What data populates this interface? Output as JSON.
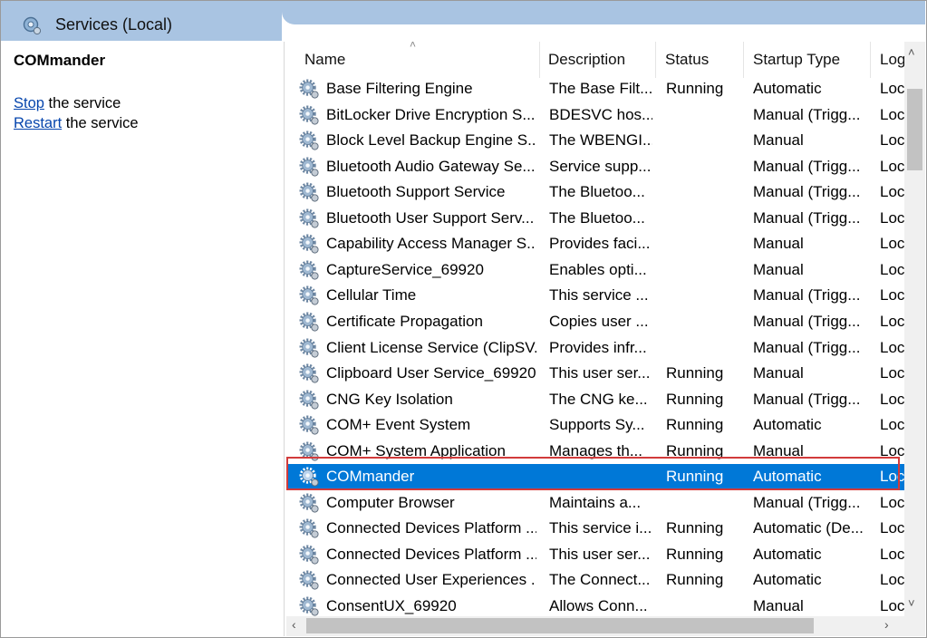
{
  "window": {
    "title": "Services (Local)"
  },
  "left_pane": {
    "selected_service": "COMmander",
    "actions": [
      {
        "link": "Stop",
        "rest": " the service"
      },
      {
        "link": "Restart",
        "rest": " the service"
      }
    ]
  },
  "table": {
    "columns": [
      "Name",
      "Description",
      "Status",
      "Startup Type",
      "Log"
    ],
    "rows": [
      {
        "name": "Base Filtering Engine",
        "description": "The Base Filt...",
        "status": "Running",
        "startup": "Automatic",
        "log": "Loc"
      },
      {
        "name": "BitLocker Drive Encryption S...",
        "description": "BDESVC hos...",
        "status": "",
        "startup": "Manual (Trigg...",
        "log": "Loc"
      },
      {
        "name": "Block Level Backup Engine S...",
        "description": "The WBENGI...",
        "status": "",
        "startup": "Manual",
        "log": "Loc"
      },
      {
        "name": "Bluetooth Audio Gateway Se...",
        "description": "Service supp...",
        "status": "",
        "startup": "Manual (Trigg...",
        "log": "Loc"
      },
      {
        "name": "Bluetooth Support Service",
        "description": "The Bluetoo...",
        "status": "",
        "startup": "Manual (Trigg...",
        "log": "Loc"
      },
      {
        "name": "Bluetooth User Support Serv...",
        "description": "The Bluetoo...",
        "status": "",
        "startup": "Manual (Trigg...",
        "log": "Loc"
      },
      {
        "name": "Capability Access Manager S...",
        "description": "Provides faci...",
        "status": "",
        "startup": "Manual",
        "log": "Loc"
      },
      {
        "name": "CaptureService_69920",
        "description": "Enables opti...",
        "status": "",
        "startup": "Manual",
        "log": "Loc"
      },
      {
        "name": "Cellular Time",
        "description": "This service ...",
        "status": "",
        "startup": "Manual (Trigg...",
        "log": "Loc"
      },
      {
        "name": "Certificate Propagation",
        "description": "Copies user ...",
        "status": "",
        "startup": "Manual (Trigg...",
        "log": "Loc"
      },
      {
        "name": "Client License Service (ClipSV...",
        "description": "Provides infr...",
        "status": "",
        "startup": "Manual (Trigg...",
        "log": "Loc"
      },
      {
        "name": "Clipboard User Service_69920",
        "description": "This user ser...",
        "status": "Running",
        "startup": "Manual",
        "log": "Loc"
      },
      {
        "name": "CNG Key Isolation",
        "description": "The CNG ke...",
        "status": "Running",
        "startup": "Manual (Trigg...",
        "log": "Loc"
      },
      {
        "name": "COM+ Event System",
        "description": "Supports Sy...",
        "status": "Running",
        "startup": "Automatic",
        "log": "Loc"
      },
      {
        "name": "COM+ System Application",
        "description": "Manages th...",
        "status": "Running",
        "startup": "Manual",
        "log": "Loc"
      },
      {
        "name": "COMmander",
        "description": "",
        "status": "Running",
        "startup": "Automatic",
        "log": "Loc",
        "selected": true
      },
      {
        "name": "Computer Browser",
        "description": "Maintains a...",
        "status": "",
        "startup": "Manual (Trigg...",
        "log": "Loc"
      },
      {
        "name": "Connected Devices Platform ...",
        "description": "This service i...",
        "status": "Running",
        "startup": "Automatic (De...",
        "log": "Loc"
      },
      {
        "name": "Connected Devices Platform ...",
        "description": "This user ser...",
        "status": "Running",
        "startup": "Automatic",
        "log": "Loc"
      },
      {
        "name": "Connected User Experiences ...",
        "description": "The Connect...",
        "status": "Running",
        "startup": "Automatic",
        "log": "Loc"
      },
      {
        "name": "ConsentUX_69920",
        "description": "Allows Conn...",
        "status": "",
        "startup": "Manual",
        "log": "Loc"
      }
    ]
  },
  "icons": {
    "title": "services-gear-icon",
    "row": "service-gear-icon"
  },
  "colors": {
    "selection": "#0078d7",
    "highlight_box": "#d23b3b",
    "link": "#0645ad",
    "title_band": "#a9c4e2"
  }
}
